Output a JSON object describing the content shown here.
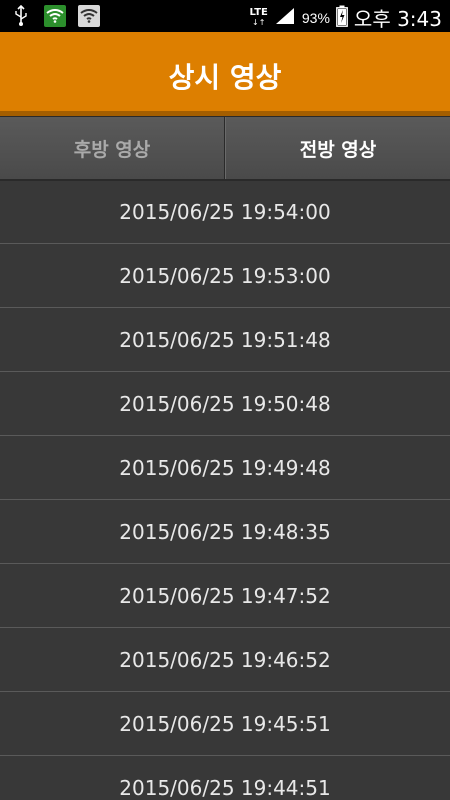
{
  "status_bar": {
    "icons": [
      "usb-icon",
      "wifi-icon",
      "wifi-icon",
      "lte-icon",
      "signal-icon",
      "battery-icon"
    ],
    "network": "LTE",
    "battery_percent": "93%",
    "time": "오후 3:43"
  },
  "header": {
    "title": "상시 영상"
  },
  "tabs": [
    {
      "label": "후방 영상",
      "selected": false
    },
    {
      "label": "전방 영상",
      "selected": true
    }
  ],
  "recordings": [
    "2015/06/25 19:54:00",
    "2015/06/25 19:53:00",
    "2015/06/25 19:51:48",
    "2015/06/25 19:50:48",
    "2015/06/25 19:49:48",
    "2015/06/25 19:48:35",
    "2015/06/25 19:47:52",
    "2015/06/25 19:46:52",
    "2015/06/25 19:45:51",
    "2015/06/25 19:44:51"
  ],
  "colors": {
    "header": "#dd7f00",
    "background": "#383838"
  }
}
